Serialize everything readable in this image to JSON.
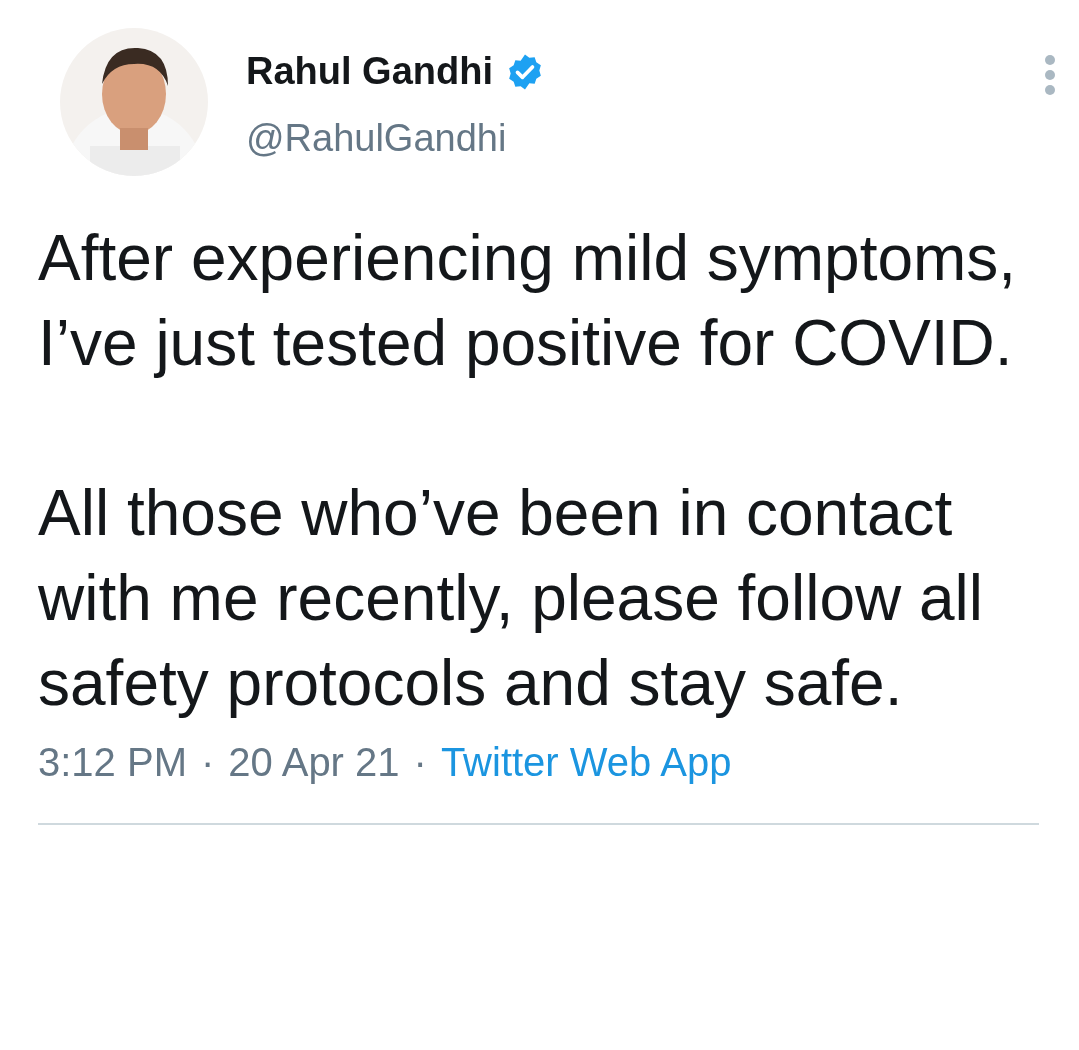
{
  "author": {
    "name": "Rahul Gandhi",
    "verified": true,
    "handle": "@RahulGandhi"
  },
  "menu": {
    "kind": "more"
  },
  "body": [
    "After experiencing mild symptoms, I’ve just tested positive for COVID.",
    "All those who’ve been in contact with me recently, please follow all safety protocols and stay safe."
  ],
  "meta": {
    "time": "3:12 PM",
    "separator": "·",
    "date": "20 Apr 21",
    "source": "Twitter Web App"
  }
}
